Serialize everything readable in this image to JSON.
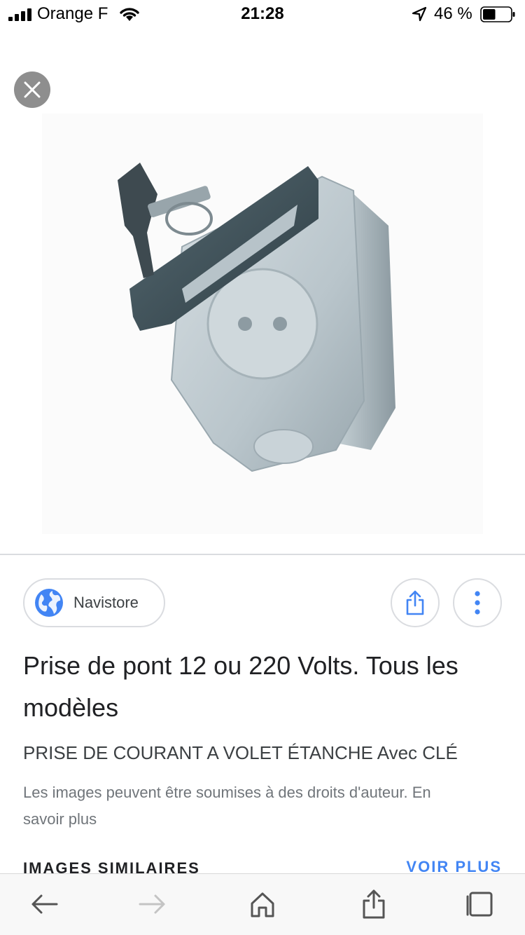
{
  "status_bar": {
    "carrier": "Orange F",
    "time": "21:28",
    "battery": "46 %",
    "battery_level": 0.46
  },
  "image": {
    "icon": "product-photo"
  },
  "close_icon": "close-icon",
  "source": {
    "name": "Navistore",
    "icon": "globe-icon"
  },
  "title": "Prise de pont 12 ou 220 Volts. Tous les modèles",
  "subtitle": "PRISE DE COURANT A VOLET ÉTANCHE Avec CLÉ",
  "notice": "Les images peuvent être soumises à des droits d'auteur. En savoir plus",
  "similar": {
    "title": "IMAGES SIMILAIRES",
    "see_more": "VOIR PLUS"
  },
  "colors": {
    "accent": "#4285f4",
    "close_bg": "#8e8e8e",
    "toolbar_icon": "#555555"
  }
}
